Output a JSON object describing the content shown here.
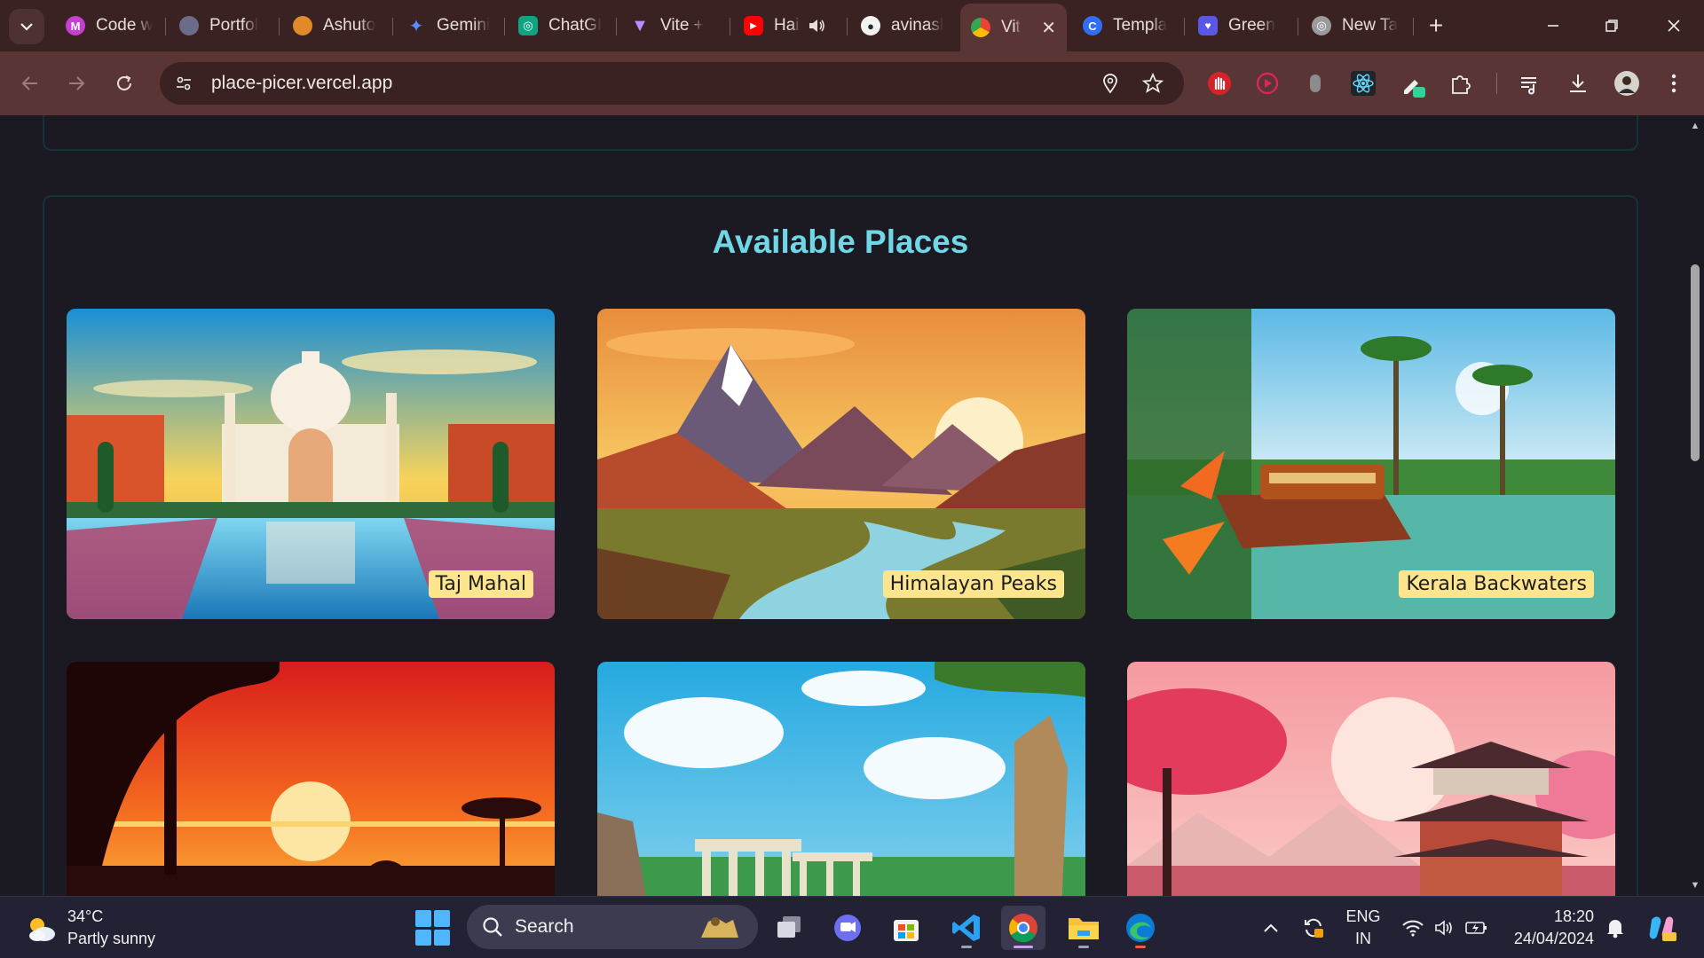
{
  "browser": {
    "tabs": [
      {
        "title": "Code w",
        "color": "#d04ad8",
        "glyph": "M"
      },
      {
        "title": "Portfol",
        "color": "#6b6b8a",
        "glyph": ""
      },
      {
        "title": "Ashuto",
        "color": "#e08a2a",
        "glyph": ""
      },
      {
        "title": "Gemini",
        "color": "#5a8cff",
        "glyph": "✦"
      },
      {
        "title": "ChatGI",
        "color": "#10a37f",
        "glyph": "◎"
      },
      {
        "title": "Vite +",
        "color": "#9b5cf6",
        "glyph": "▼"
      },
      {
        "title": "Hai",
        "color": "#ff0000",
        "glyph": "▶"
      },
      {
        "title": "avinasl",
        "color": "#24292e",
        "glyph": "●"
      },
      {
        "title": "Vit",
        "color": "#f4b400",
        "glyph": "◉",
        "active": true
      },
      {
        "title": "Templa",
        "color": "#2f6ef5",
        "glyph": "C"
      },
      {
        "title": "Green",
        "color": "#5b57e6",
        "glyph": "♥"
      },
      {
        "title": "New Ta",
        "color": "#9b9b9b",
        "glyph": "◎"
      }
    ],
    "tab_audio_icon": "speaker-icon",
    "new_tab_label": "+",
    "url": "place-picer.vercel.app"
  },
  "page": {
    "section_title": "Available Places",
    "places": [
      {
        "title": "Taj Mahal",
        "scene": "taj"
      },
      {
        "title": "Himalayan Peaks",
        "scene": "himalaya"
      },
      {
        "title": "Kerala Backwaters",
        "scene": "kerala"
      },
      {
        "title": "",
        "scene": "savanna"
      },
      {
        "title": "",
        "scene": "ruins"
      },
      {
        "title": "",
        "scene": "pagoda"
      }
    ]
  },
  "taskbar": {
    "weather_temp": "34°C",
    "weather_desc": "Partly sunny",
    "search_placeholder": "Search",
    "lang_line1": "ENG",
    "lang_line2": "IN",
    "time": "18:20",
    "date": "24/04/2024"
  },
  "colors": {
    "accent": "#6fd7e6",
    "caption_bg": "#fce58c",
    "page_bg": "#1b1a22",
    "chrome_frame": "#3a2122",
    "chrome_toolbar": "#5a3536"
  }
}
